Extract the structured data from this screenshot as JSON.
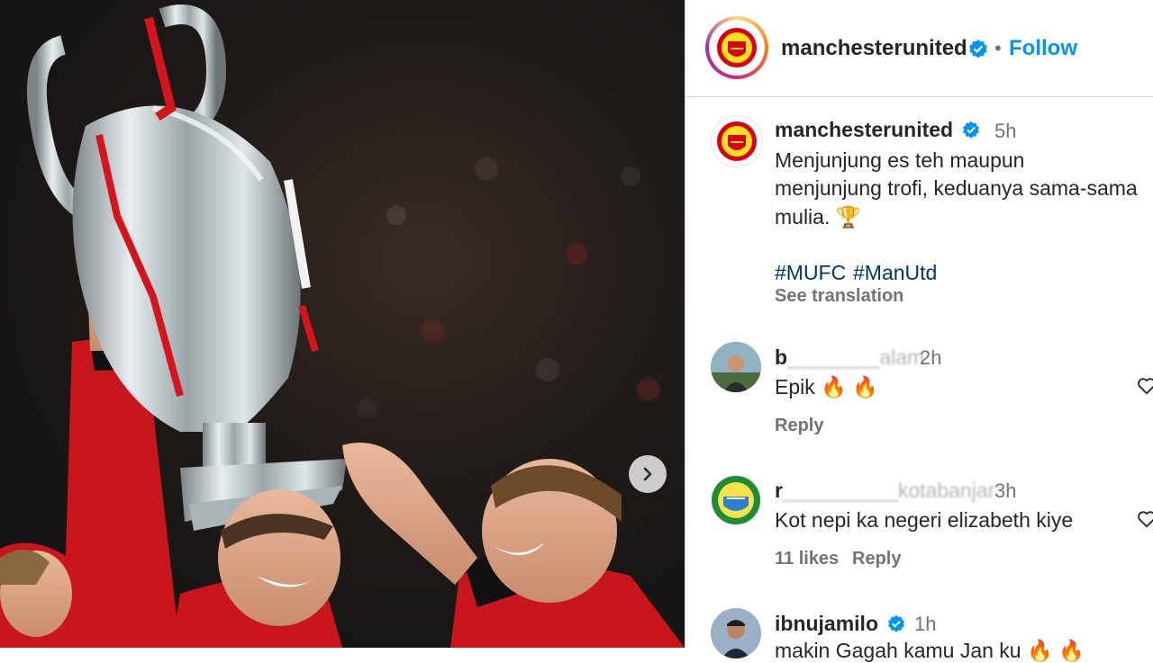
{
  "post": {
    "account": "manchesterunited",
    "follow_label": "Follow",
    "separator": "•",
    "next_label": "›"
  },
  "caption": {
    "username": "manchesterunited",
    "time": "5h",
    "lines": [
      "Menjunjung es teh maupun",
      "menjunjung trofi, keduanya sama-sama",
      "mulia. 🏆"
    ],
    "hashtags": [
      "#MUFC",
      "#ManUtd"
    ],
    "see_translation": "See translation"
  },
  "comments": [
    {
      "username": "b",
      "username_rest": "________alam",
      "time": "2h",
      "text": "Epik 🔥 🔥",
      "reply_label": "Reply"
    },
    {
      "username": "r",
      "username_rest": "__________kotabanjar",
      "time": "3h",
      "text": "Kot nepi ka negeri elizabeth kiye",
      "likes": "11 likes",
      "reply_label": "Reply"
    },
    {
      "username": "ibnujamilo",
      "time": "1h",
      "text": "makin Gagah kamu Jan ku 🔥 🔥"
    }
  ],
  "colors": {
    "accent": "#0095f6",
    "verified": "#0095f6",
    "hashtag": "#00376b",
    "muted": "#737373",
    "club_red": "#da020e",
    "club_gold": "#fbe122"
  },
  "icons": {
    "verified": "verified-badge-icon",
    "heart": "heart-outline-icon",
    "next": "chevron-right-icon",
    "trophy": "trophy-emoji"
  }
}
